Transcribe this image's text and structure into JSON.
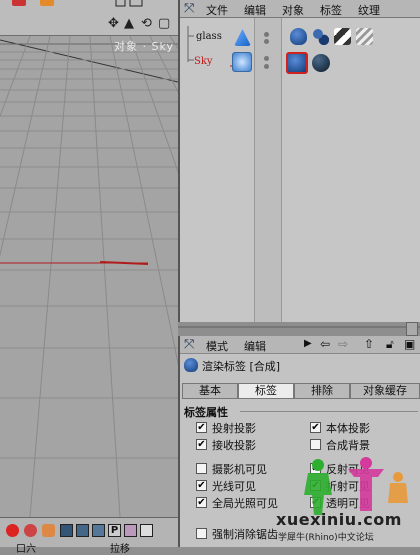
{
  "viewport": {
    "label": "对象 · Sky",
    "toolbar_icons": [
      "move-view-icon",
      "zoom-view-icon",
      "rotate-view-icon",
      "maximize-icon"
    ],
    "bottom_labels": [
      "口六",
      "拉移"
    ]
  },
  "object_manager": {
    "menu": [
      "文件",
      "编辑",
      "对象",
      "标签",
      "纹理"
    ],
    "objects": [
      {
        "name": "glass",
        "color": "#222222"
      },
      {
        "name": "Sky",
        "color": "#c01818"
      }
    ]
  },
  "attribute_manager": {
    "menu": [
      "模式",
      "编辑"
    ],
    "title": "渲染标签 [合成]",
    "tabs": [
      {
        "label": "基本",
        "active": false
      },
      {
        "label": "标签",
        "active": true
      },
      {
        "label": "排除",
        "active": false
      },
      {
        "label": "对象缓存",
        "active": false
      }
    ],
    "section_title": "标签属性",
    "checkboxes": [
      {
        "label": "投射投影",
        "checked": true
      },
      {
        "label": "本体投影",
        "checked": true
      },
      {
        "label": "接收投影",
        "checked": true
      },
      {
        "label": "合成背景",
        "checked": false
      },
      {
        "label": "摄影机可见",
        "checked": false
      },
      {
        "label": "反射可见",
        "checked": true
      },
      {
        "label": "光线可见",
        "checked": true
      },
      {
        "label": "折射可见",
        "checked": true
      },
      {
        "label": "全局光照可见",
        "checked": true
      },
      {
        "label": "透明可见",
        "checked": true
      },
      {
        "label": "强制消除锯齿",
        "checked": false
      }
    ]
  },
  "watermark": {
    "site": "xuexiniu.com",
    "caption": "学犀牛(Rhino)中文论坛"
  }
}
